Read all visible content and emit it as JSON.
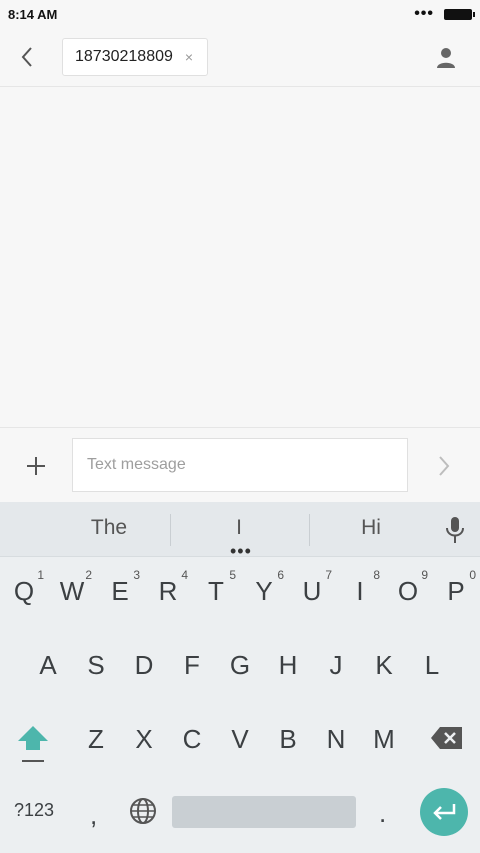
{
  "status_bar": {
    "time": "8:14 AM",
    "dots": "•••"
  },
  "header": {
    "recipient": "18730218809",
    "remove_glyph": "×"
  },
  "compose": {
    "placeholder": "Text message"
  },
  "keyboard": {
    "suggestions": [
      "The",
      "I",
      "Hi"
    ],
    "more_dots": "•••",
    "row1": [
      {
        "key": "Q",
        "hint": "1"
      },
      {
        "key": "W",
        "hint": "2"
      },
      {
        "key": "E",
        "hint": "3"
      },
      {
        "key": "R",
        "hint": "4"
      },
      {
        "key": "T",
        "hint": "5"
      },
      {
        "key": "Y",
        "hint": "6"
      },
      {
        "key": "U",
        "hint": "7"
      },
      {
        "key": "I",
        "hint": "8"
      },
      {
        "key": "O",
        "hint": "9"
      },
      {
        "key": "P",
        "hint": "0"
      }
    ],
    "row2": [
      "A",
      "S",
      "D",
      "F",
      "G",
      "H",
      "J",
      "K",
      "L"
    ],
    "row3": [
      "Z",
      "X",
      "C",
      "V",
      "B",
      "N",
      "M"
    ],
    "symbols_label": "?123",
    "comma": ",",
    "period": "."
  },
  "colors": {
    "accent": "#4db6ac",
    "shift": "#4db6ac"
  }
}
